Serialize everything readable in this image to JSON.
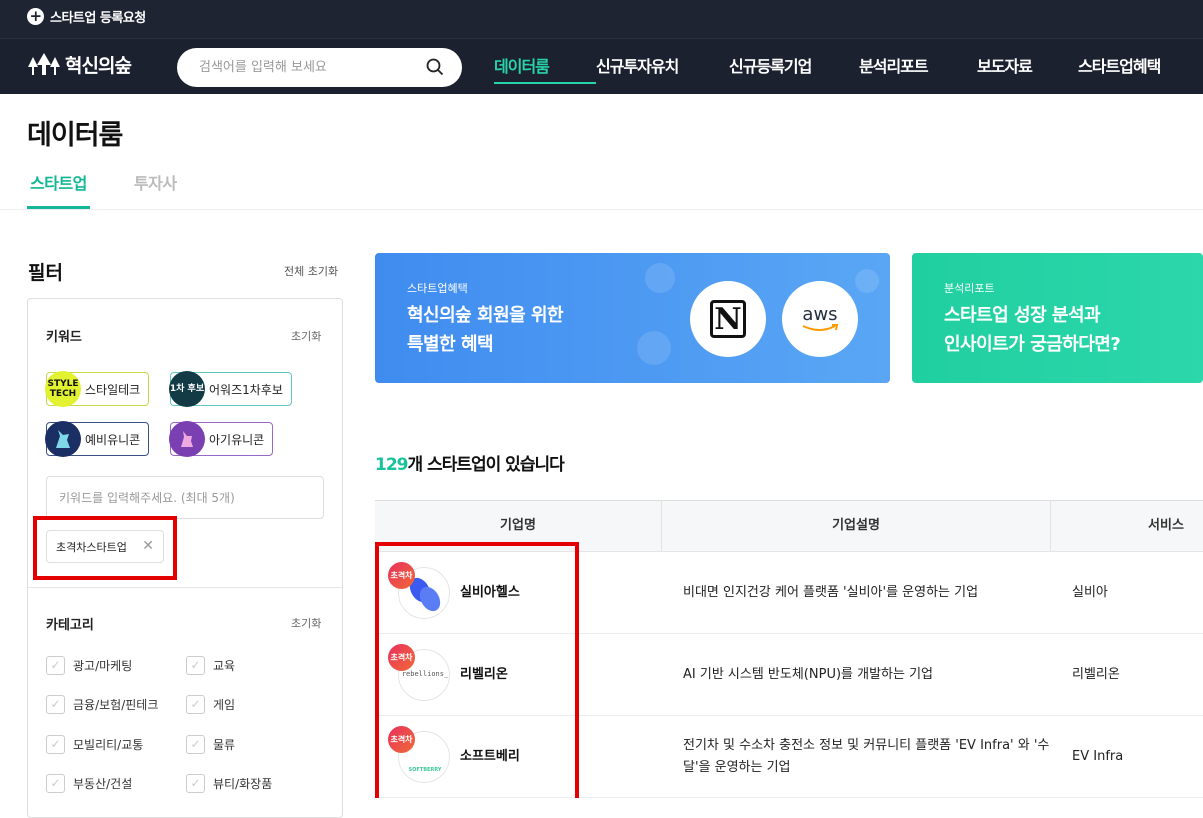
{
  "topbar": {
    "register_label": "스타트업 등록요청"
  },
  "header": {
    "logo_text": "혁신의숲",
    "search_placeholder": "검색어를 입력해 보세요",
    "nav": [
      {
        "label": "데이터룸",
        "active": true
      },
      {
        "label": "신규투자유치",
        "active": false
      },
      {
        "label": "신규등록기업",
        "active": false
      },
      {
        "label": "분석리포트",
        "active": false
      },
      {
        "label": "보도자료",
        "active": false
      },
      {
        "label": "스타트업혜택",
        "active": false
      }
    ]
  },
  "page": {
    "title": "데이터룸",
    "tabs": [
      {
        "label": "스타트업",
        "active": true
      },
      {
        "label": "투자사",
        "active": false
      }
    ]
  },
  "filter": {
    "title": "필터",
    "reset_all": "전체 초기화",
    "keyword": {
      "label": "키워드",
      "reset": "초기화",
      "chips": [
        {
          "label": "스타일테크",
          "icon_text": "STYLE TECH",
          "color": "#e3f230"
        },
        {
          "label": "어워즈1차후보",
          "icon_text": "1차 후보",
          "color": "#14a8a0"
        },
        {
          "label": "예비유니콘",
          "icon_text": "",
          "color": "#1a2f63"
        },
        {
          "label": "아기유니콘",
          "icon_text": "",
          "color": "#7a3fb0"
        }
      ],
      "input_placeholder": "키워드를 입력해주세요. (최대 5개)",
      "selected_tag": "초격차스타트업"
    },
    "category": {
      "label": "카테고리",
      "reset": "초기화",
      "items": [
        "광고/마케팅",
        "교육",
        "금융/보험/핀테크",
        "게임",
        "모빌리티/교통",
        "물류",
        "부동산/건설",
        "뷰티/화장품"
      ]
    }
  },
  "banners": [
    {
      "small": "스타트업혜택",
      "big": "혁신의숲 회원을 위한\n특별한 혜택",
      "color": "#3a8ff0",
      "logo1": "N",
      "logo2": "aws"
    },
    {
      "small": "분석리포트",
      "big": "스타트업 성장 분석과\n인사이트가 궁금하다면?",
      "color": "#1fcfa0"
    }
  ],
  "results": {
    "count": "129",
    "suffix": "개 스타트업이 있습니다",
    "columns": [
      "기업명",
      "기업설명",
      "서비스"
    ],
    "badge_label": "초격차",
    "rows": [
      {
        "name": "실비아헬스",
        "desc": "비대면 인지건강 케어 플랫폼 '실비아'를 운영하는 기업",
        "service": "실비아",
        "logo_text": ""
      },
      {
        "name": "리벨리온",
        "desc": "AI 기반 시스템 반도체(NPU)를 개발하는 기업",
        "service": "리벨리온",
        "logo_text": "rebellions_"
      },
      {
        "name": "소프트베리",
        "desc": "전기차 및 수소차 충전소 정보 및 커뮤니티 플랫폼 'EV Infra' 와 '수달'을 운영하는 기업",
        "service": "EV Infra",
        "logo_text": "SOFTBERRY"
      }
    ]
  }
}
